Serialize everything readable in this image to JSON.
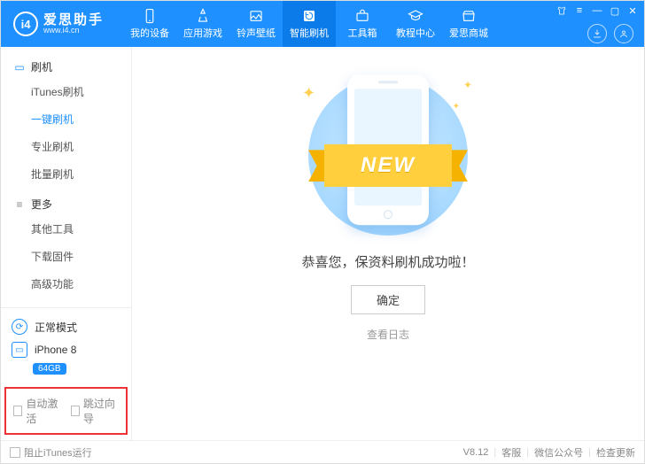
{
  "logo": {
    "initials": "i4",
    "title": "爱思助手",
    "subtitle": "www.i4.cn"
  },
  "nav": {
    "items": [
      {
        "label": "我的设备"
      },
      {
        "label": "应用游戏"
      },
      {
        "label": "铃声壁纸"
      },
      {
        "label": "智能刷机"
      },
      {
        "label": "工具箱"
      },
      {
        "label": "教程中心"
      },
      {
        "label": "爱思商城"
      }
    ]
  },
  "sidebar": {
    "sections": [
      {
        "title": "刷机",
        "items": [
          "iTunes刷机",
          "一键刷机",
          "专业刷机",
          "批量刷机"
        ]
      },
      {
        "title": "更多",
        "items": [
          "其他工具",
          "下载固件",
          "高级功能"
        ]
      }
    ],
    "mode_label": "正常模式",
    "device_name": "iPhone 8",
    "device_storage": "64GB",
    "auto_activate_label": "自动激活",
    "skip_guide_label": "跳过向导"
  },
  "main": {
    "ribbon": "NEW",
    "message": "恭喜您，保资料刷机成功啦！",
    "ok": "确定",
    "view_log": "查看日志"
  },
  "footer": {
    "block_itunes": "阻止iTunes运行",
    "version": "V8.12",
    "support": "客服",
    "wechat": "微信公众号",
    "update": "检查更新"
  }
}
